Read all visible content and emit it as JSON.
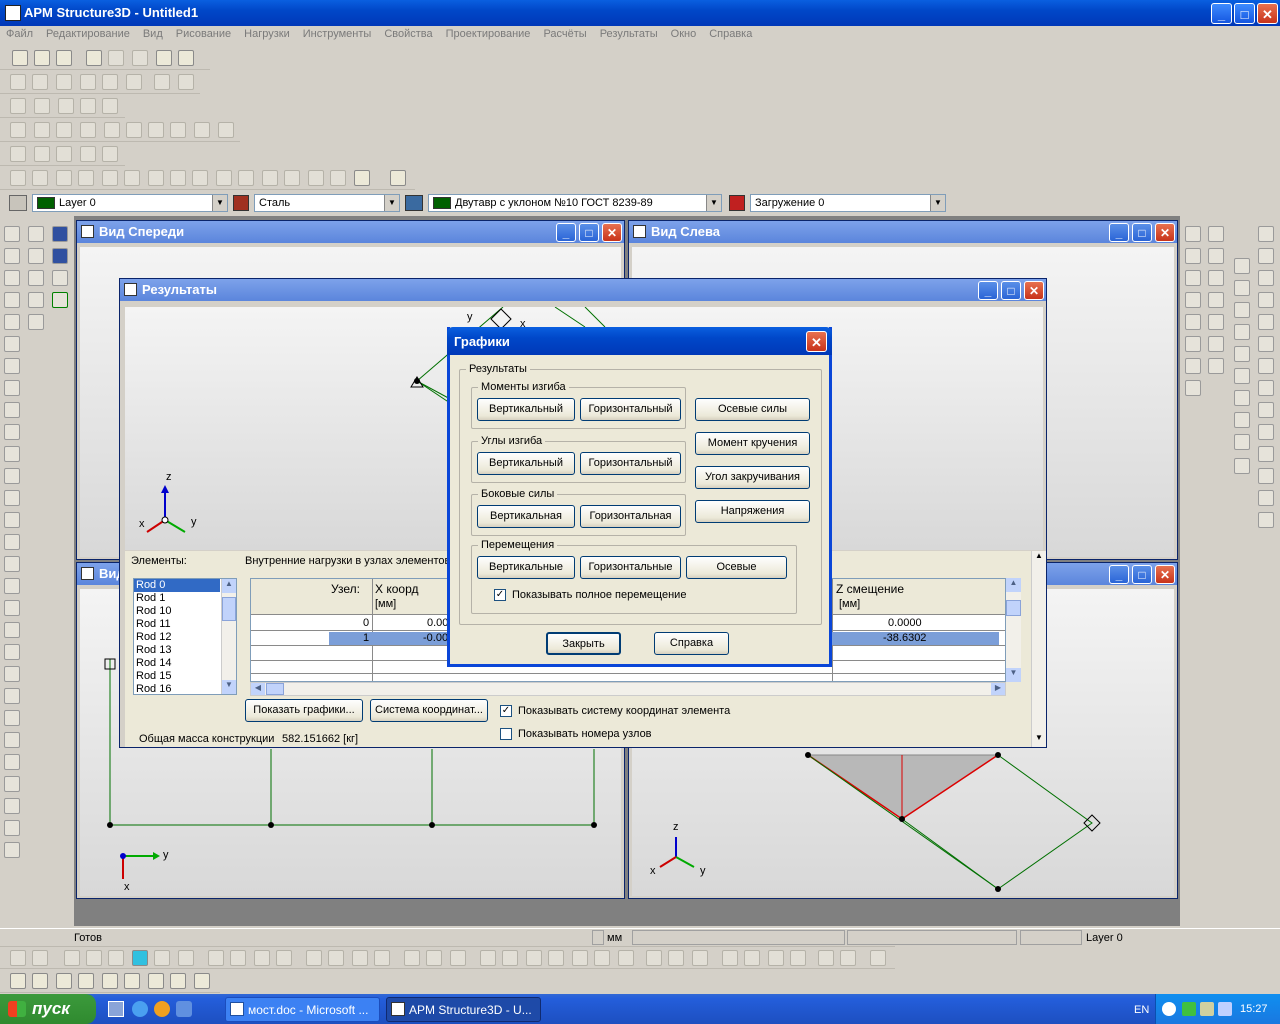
{
  "app_title": "APM Structure3D - Untitled1",
  "menu": [
    "Файл",
    "Редактирование",
    "Вид",
    "Рисование",
    "Нагрузки",
    "Инструменты",
    "Свойства",
    "Проектирование",
    "Расчёты",
    "Результаты",
    "Окно",
    "Справка"
  ],
  "props_bar": {
    "layer": "Layer 0",
    "material": "Сталь",
    "section": "Двутавр с уклоном  №10 ГОСТ 8239-89",
    "loading": "Загружение 0"
  },
  "windows": {
    "front": "Вид Спереди",
    "left": "Вид Слева",
    "bottom_left": "Вид",
    "results": "Результаты"
  },
  "results": {
    "elements_label": "Элементы:",
    "nodes_caption": "Внутренние нагрузки в узлах элементов",
    "elements": [
      "Rod 0",
      "Rod 1",
      "Rod 10",
      "Rod 11",
      "Rod 12",
      "Rod 13",
      "Rod 14",
      "Rod 15",
      "Rod 16"
    ],
    "col_node": "Узел:",
    "col_x": "X коорд",
    "col_x_unit": "[мм]",
    "col_z": "Z смещение",
    "col_z_unit": "[мм]",
    "rows": [
      {
        "node": "0",
        "x": "0.00",
        "z": "0.0000"
      },
      {
        "node": "1",
        "x": "-0.00",
        "z": "-38.6302"
      }
    ],
    "show_graphs": "Показать графики...",
    "coord_system": "Система координат...",
    "show_elem_cs": "Показывать систему координат элемента",
    "show_node_nums": "Показывать номера узлов",
    "total_mass_label": "Общая масса конструкции",
    "total_mass_value": "582.151662 [кг]"
  },
  "dialog": {
    "title": "Графики",
    "results_group": "Результаты",
    "bending": "Моменты изгиба",
    "angles": "Углы изгиба",
    "lateral": "Боковые силы",
    "displacements": "Перемещения",
    "vert": "Вертикальный",
    "horiz": "Горизонтальный",
    "vert_f": "Вертикальная",
    "horiz_f": "Горизонтальная",
    "vert_pl": "Вертикальные",
    "horiz_pl": "Горизонтальные",
    "axial_pl": "Осевые",
    "axial_forces": "Осевые силы",
    "torque": "Момент кручения",
    "twist": "Угол закручивания",
    "stress": "Напряжения",
    "show_full": "Показывать полное перемещение",
    "close": "Закрыть",
    "help": "Справка"
  },
  "axes": {
    "x": "x",
    "y": "y",
    "z": "z"
  },
  "status": {
    "ready": "Готов",
    "units": "мм",
    "layer": "Layer 0"
  },
  "taskbar": {
    "start": "пуск",
    "task1": "мост.doc - Microsoft ...",
    "task2": "APM Structure3D - U...",
    "lang": "EN",
    "time": "15:27"
  }
}
